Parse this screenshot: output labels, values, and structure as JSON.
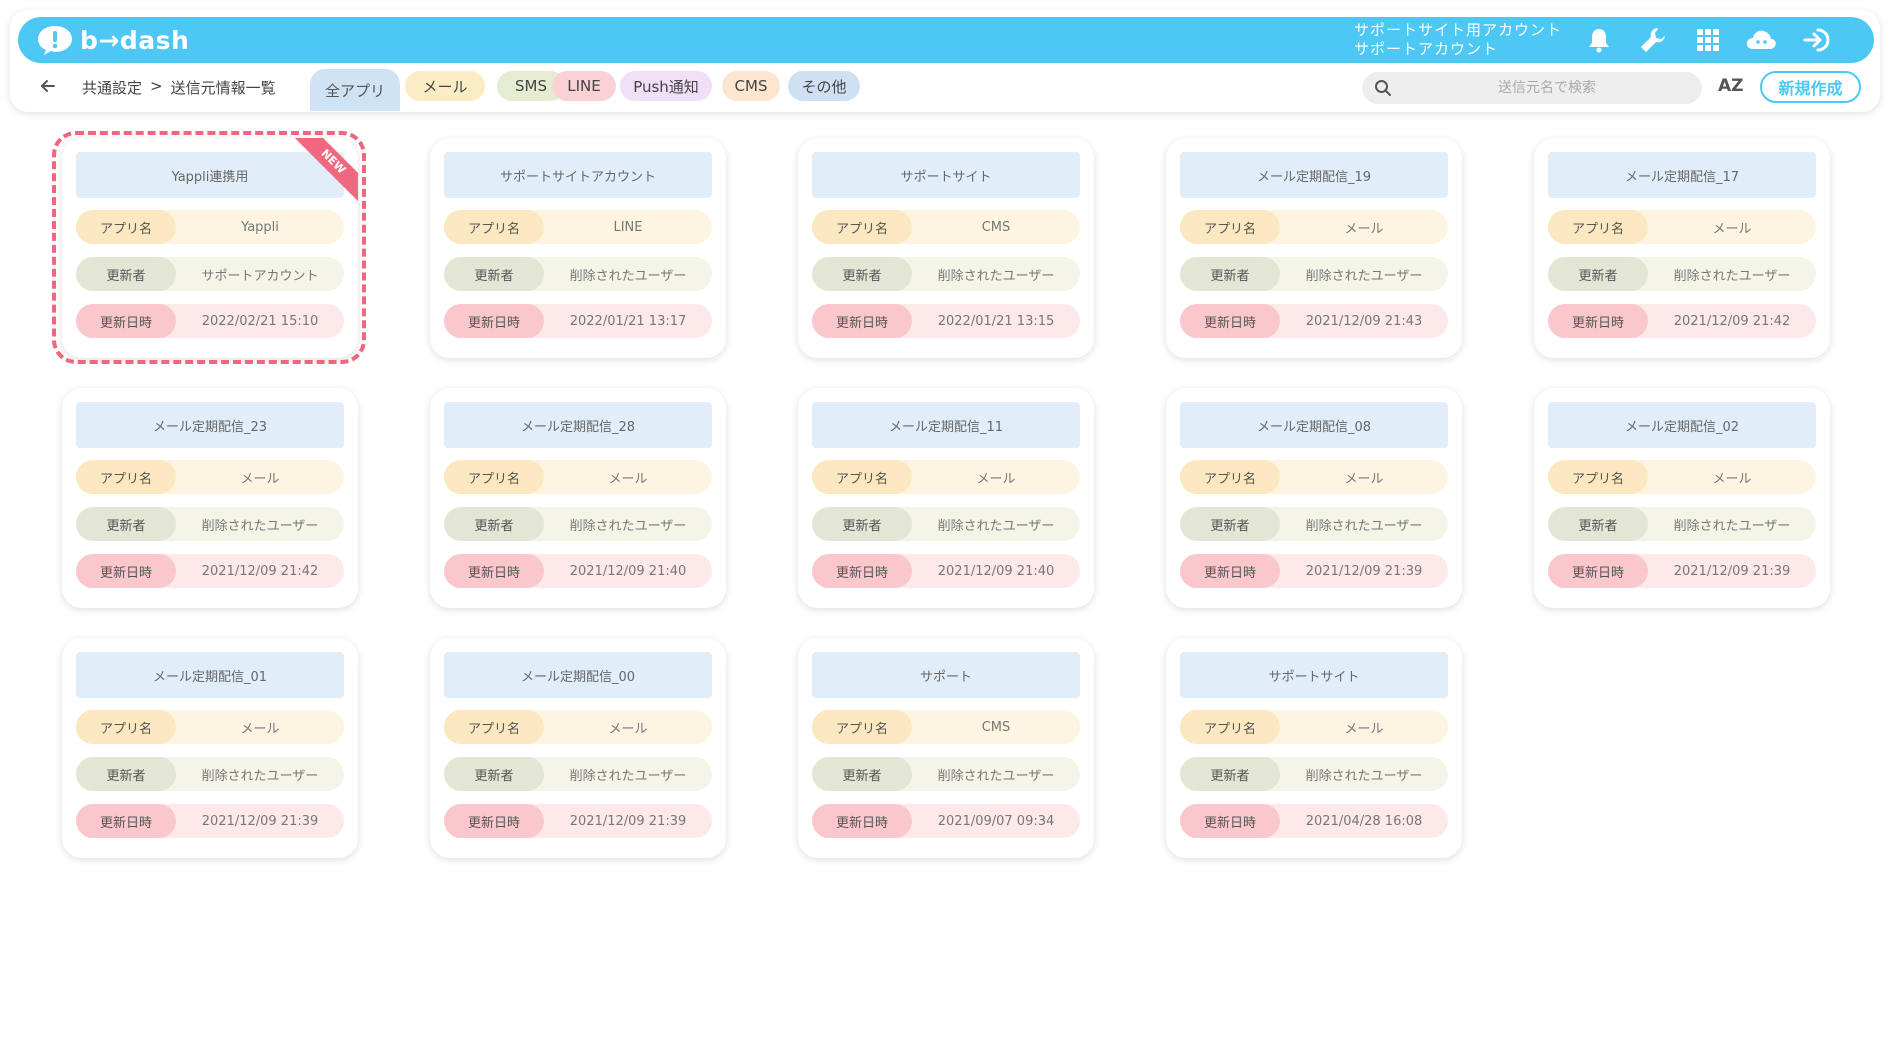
{
  "header": {
    "logo_text": "b→dash",
    "account_line1": "サポートサイト用アカウント",
    "account_line2": "サポートアカウント",
    "accent_color": "#4dc8f5",
    "icons": [
      "bell-icon",
      "wrench-icon",
      "grid-icon",
      "cloud-icon",
      "logout-icon"
    ]
  },
  "breadcrumb": {
    "parent": "共通設定",
    "separator": ">",
    "current": "送信元情報一覧"
  },
  "tabs": [
    {
      "label": "全アプリ",
      "color": "#cfe3f4",
      "active": true
    },
    {
      "label": "メール",
      "color": "#fbecc3"
    },
    {
      "label": "SMS",
      "color": "#e6ecd2"
    },
    {
      "label": "LINE",
      "color": "#fad2d6"
    },
    {
      "label": "Push通知",
      "color": "#f1def7"
    },
    {
      "label": "CMS",
      "color": "#fce6cf"
    },
    {
      "label": "その他",
      "color": "#cfe0f2"
    }
  ],
  "search": {
    "placeholder": "送信元名で検索"
  },
  "sort_label": "AZ",
  "new_button": "新規作成",
  "labels": {
    "app": "アプリ名",
    "updater": "更新者",
    "updated_at": "更新日時"
  },
  "new_badge": "NEW",
  "cards": [
    {
      "title": "Yappli連携用",
      "app": "Yappli",
      "updater": "サポートアカウント",
      "updated_at": "2022/02/21 15:10",
      "is_new": true
    },
    {
      "title": "サポートサイトアカウント",
      "app": "LINE",
      "updater": "削除されたユーザー",
      "updated_at": "2022/01/21 13:17"
    },
    {
      "title": "サポートサイト",
      "app": "CMS",
      "updater": "削除されたユーザー",
      "updated_at": "2022/01/21 13:15"
    },
    {
      "title": "メール定期配信_19",
      "app": "メール",
      "updater": "削除されたユーザー",
      "updated_at": "2021/12/09 21:43"
    },
    {
      "title": "メール定期配信_17",
      "app": "メール",
      "updater": "削除されたユーザー",
      "updated_at": "2021/12/09 21:42"
    },
    {
      "title": "メール定期配信_23",
      "app": "メール",
      "updater": "削除されたユーザー",
      "updated_at": "2021/12/09 21:42"
    },
    {
      "title": "メール定期配信_28",
      "app": "メール",
      "updater": "削除されたユーザー",
      "updated_at": "2021/12/09 21:40"
    },
    {
      "title": "メール定期配信_11",
      "app": "メール",
      "updater": "削除されたユーザー",
      "updated_at": "2021/12/09 21:40"
    },
    {
      "title": "メール定期配信_08",
      "app": "メール",
      "updater": "削除されたユーザー",
      "updated_at": "2021/12/09 21:39"
    },
    {
      "title": "メール定期配信_02",
      "app": "メール",
      "updater": "削除されたユーザー",
      "updated_at": "2021/12/09 21:39"
    },
    {
      "title": "メール定期配信_01",
      "app": "メール",
      "updater": "削除されたユーザー",
      "updated_at": "2021/12/09 21:39"
    },
    {
      "title": "メール定期配信_00",
      "app": "メール",
      "updater": "削除されたユーザー",
      "updated_at": "2021/12/09 21:39"
    },
    {
      "title": "サポート",
      "app": "CMS",
      "updater": "削除されたユーザー",
      "updated_at": "2021/09/07 09:34"
    },
    {
      "title": "サポートサイト",
      "app": "メール",
      "updater": "削除されたユーザー",
      "updated_at": "2021/04/28 16:08"
    }
  ]
}
